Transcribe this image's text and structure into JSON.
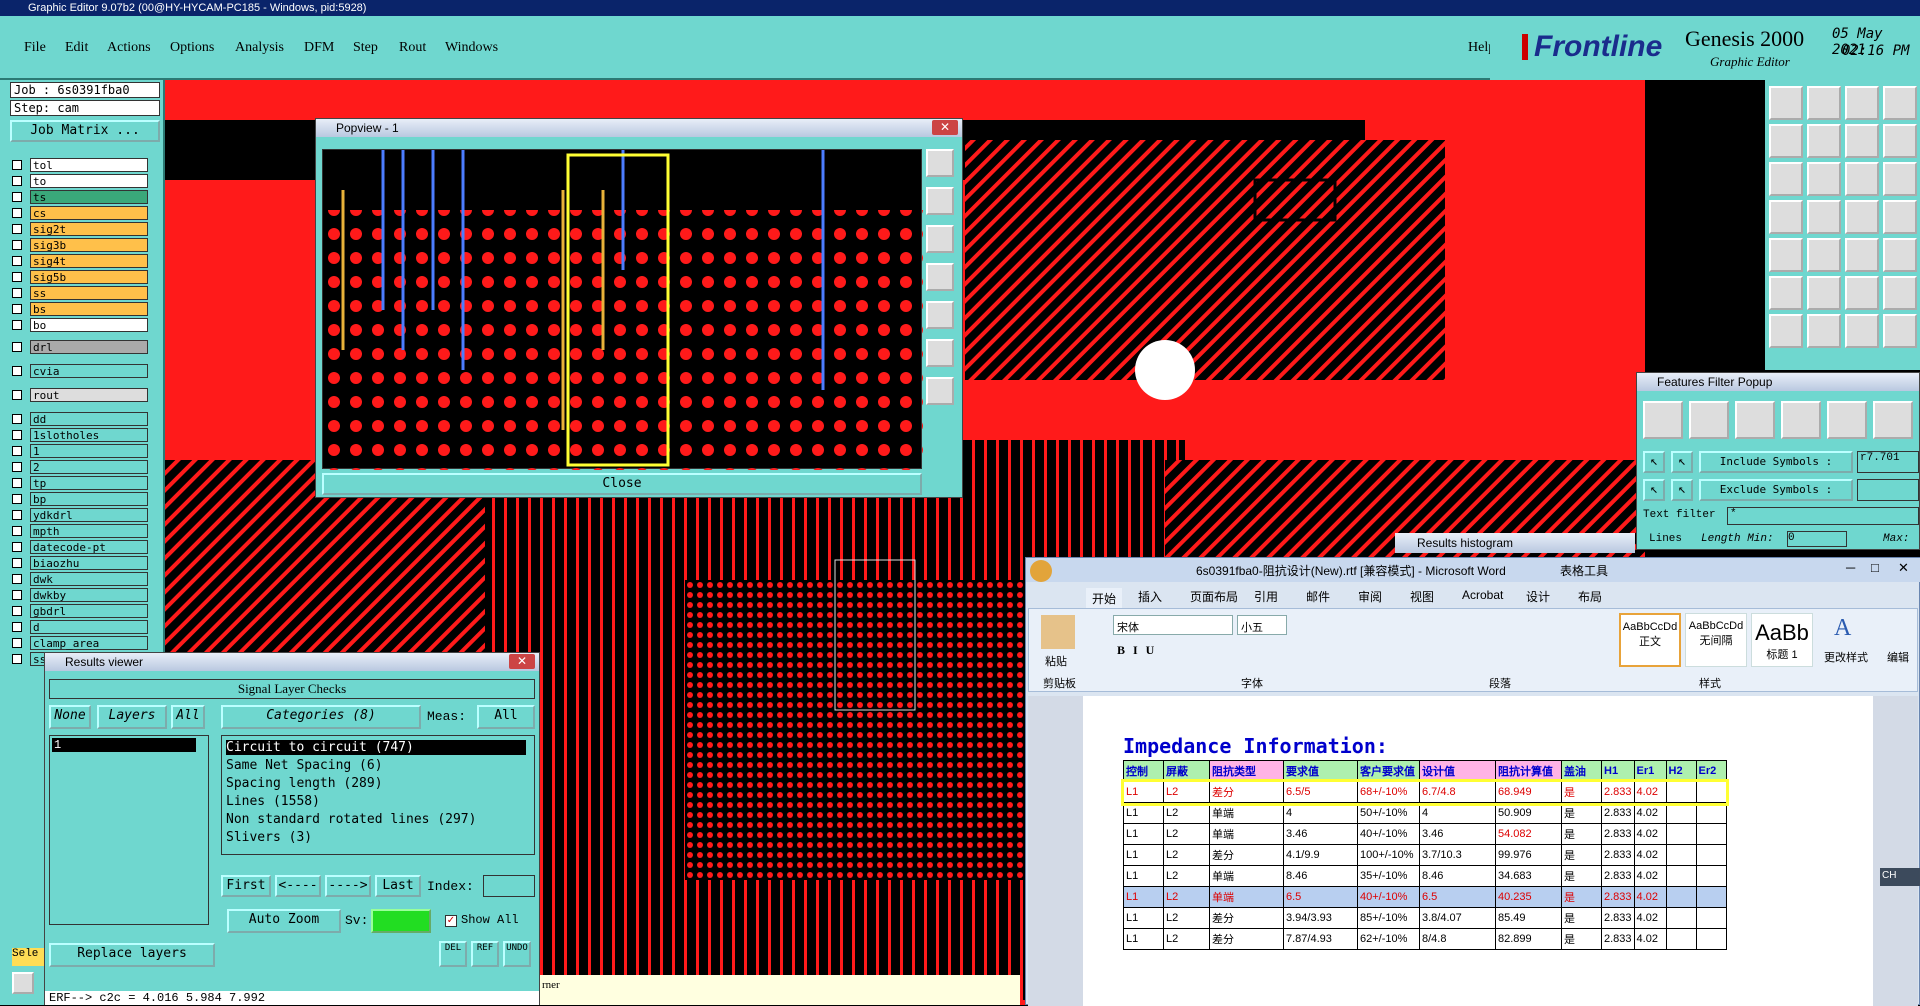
{
  "app": {
    "title": "Graphic Editor 9.07b2 (00@HY-HYCAM-PC185 - Windows, pid:5928)"
  },
  "menu": [
    "File",
    "Edit",
    "Actions",
    "Options",
    "Analysis",
    "DFM",
    "Step",
    "Rout",
    "Windows"
  ],
  "help": "Help",
  "brand": {
    "logo": "Frontline",
    "product": "Genesis 2000",
    "sub": "Graphic Editor",
    "date": "05 May 2021",
    "time": "02:16 PM"
  },
  "job": {
    "job": "Job : 6s0391fba0",
    "step": "Step: cam",
    "matrix": "Job Matrix ..."
  },
  "layers": [
    "tol",
    "to",
    "ts",
    "cs",
    "sig2t",
    "sig3b",
    "sig4t",
    "sig5b",
    "ss",
    "bs",
    "bo",
    "drl",
    "cvia",
    "rout",
    "dd",
    "1slotholes",
    "1",
    "2",
    "tp",
    "bp",
    "ydkdrl",
    "mpth",
    "datecode-pt",
    "biaozhu",
    "dwk",
    "dwkby",
    "gbdrl",
    "d",
    "clamp_area",
    "ss_clamping"
  ],
  "popview": {
    "title": "Popview - 1",
    "close": "Close"
  },
  "features_filter": {
    "title": "Features Filter Popup",
    "include": "Include Symbols :",
    "include_val": "r7.701",
    "exclude": "Exclude Symbols :",
    "text_filter": "Text filter",
    "text_val": "*",
    "lines": "Lines",
    "length_min": "Length Min:",
    "min_val": "0",
    "max": "Max:"
  },
  "histogram": {
    "title": "Results histogram"
  },
  "results": {
    "title": "Results viewer",
    "heading": "Signal Layer Checks",
    "none": "None",
    "layers": "Layers",
    "all": "All",
    "categories": "Categories (8)",
    "meas": "Meas:",
    "meas_val": "All",
    "layer_item": "1",
    "items": [
      "Circuit to circuit (747)",
      "Same Net Spacing (6)",
      "Spacing length (289)",
      "Lines (1558)",
      "Non standard rotated lines (297)",
      "Slivers (3)"
    ],
    "first": "First",
    "prev": "<----",
    "next": "---->",
    "last": "Last",
    "index": "Index:",
    "auto_zoom": "Auto Zoom",
    "sv": "Sv:",
    "show_all": "Show All",
    "replace": "Replace layers",
    "status": "ERF--> c2c = 4.016 5.984 7.992",
    "del": "DEL",
    "ref": "REF",
    "undo": "UNDO",
    "rner": "rner",
    "sel": "Sele"
  },
  "word": {
    "title": "6s0391fba0-阻抗设计(New).rtf [兼容模式] - Microsoft Word",
    "tools": "表格工具",
    "tabs": [
      "开始",
      "插入",
      "页面布局",
      "引用",
      "邮件",
      "审阅",
      "视图",
      "Acrobat",
      "设计",
      "布局"
    ],
    "font": "宋体",
    "size": "小五",
    "groups": [
      "剪贴板",
      "字体",
      "段落",
      "样式"
    ],
    "styles": [
      {
        "p": "AaBbCcDd",
        "n": "正文"
      },
      {
        "p": "AaBbCcDd",
        "n": "无间隔"
      },
      {
        "p": "AaBb",
        "n": "标题 1"
      }
    ],
    "change_style": "更改样式",
    "edit": "编辑",
    "paste": "粘贴",
    "doc_title": "Impedance Information:",
    "headers": [
      "控制",
      "屏蔽",
      "阻抗类型",
      "要求值",
      "客户要求值",
      "设计值",
      "阻抗计算值",
      "盖油",
      "H1",
      "Er1",
      "H2",
      "Er2"
    ],
    "rows": [
      [
        "L1",
        "L2",
        "差分",
        "6.5/5",
        "68+/-10%",
        "6.7/4.8",
        "68.949",
        "是",
        "2.833",
        "4.02",
        "",
        ""
      ],
      [
        "L1",
        "L2",
        "单端",
        "4",
        "50+/-10%",
        "4",
        "50.909",
        "是",
        "2.833",
        "4.02",
        "",
        ""
      ],
      [
        "L1",
        "L2",
        "单端",
        "3.46",
        "40+/-10%",
        "3.46",
        "54.082",
        "是",
        "2.833",
        "4.02",
        "",
        ""
      ],
      [
        "L1",
        "L2",
        "差分",
        "4.1/9.9",
        "100+/-10%",
        "3.7/10.3",
        "99.976",
        "是",
        "2.833",
        "4.02",
        "",
        ""
      ],
      [
        "L1",
        "L2",
        "单端",
        "8.46",
        "35+/-10%",
        "8.46",
        "34.683",
        "是",
        "2.833",
        "4.02",
        "",
        ""
      ],
      [
        "L1",
        "L2",
        "单端",
        "6.5",
        "40+/-10%",
        "6.5",
        "40.235",
        "是",
        "2.833",
        "4.02",
        "",
        ""
      ],
      [
        "L1",
        "L2",
        "差分",
        "3.94/3.93",
        "85+/-10%",
        "3.8/4.07",
        "85.49",
        "是",
        "2.833",
        "4.02",
        "",
        ""
      ],
      [
        "L1",
        "L2",
        "差分",
        "7.87/4.93",
        "62+/-10%",
        "8/4.8",
        "82.899",
        "是",
        "2.833",
        "4.02",
        "",
        ""
      ]
    ],
    "lang": "CH"
  },
  "colors": {
    "teal": "#6fd7cf",
    "red": "#ff1a1a"
  }
}
